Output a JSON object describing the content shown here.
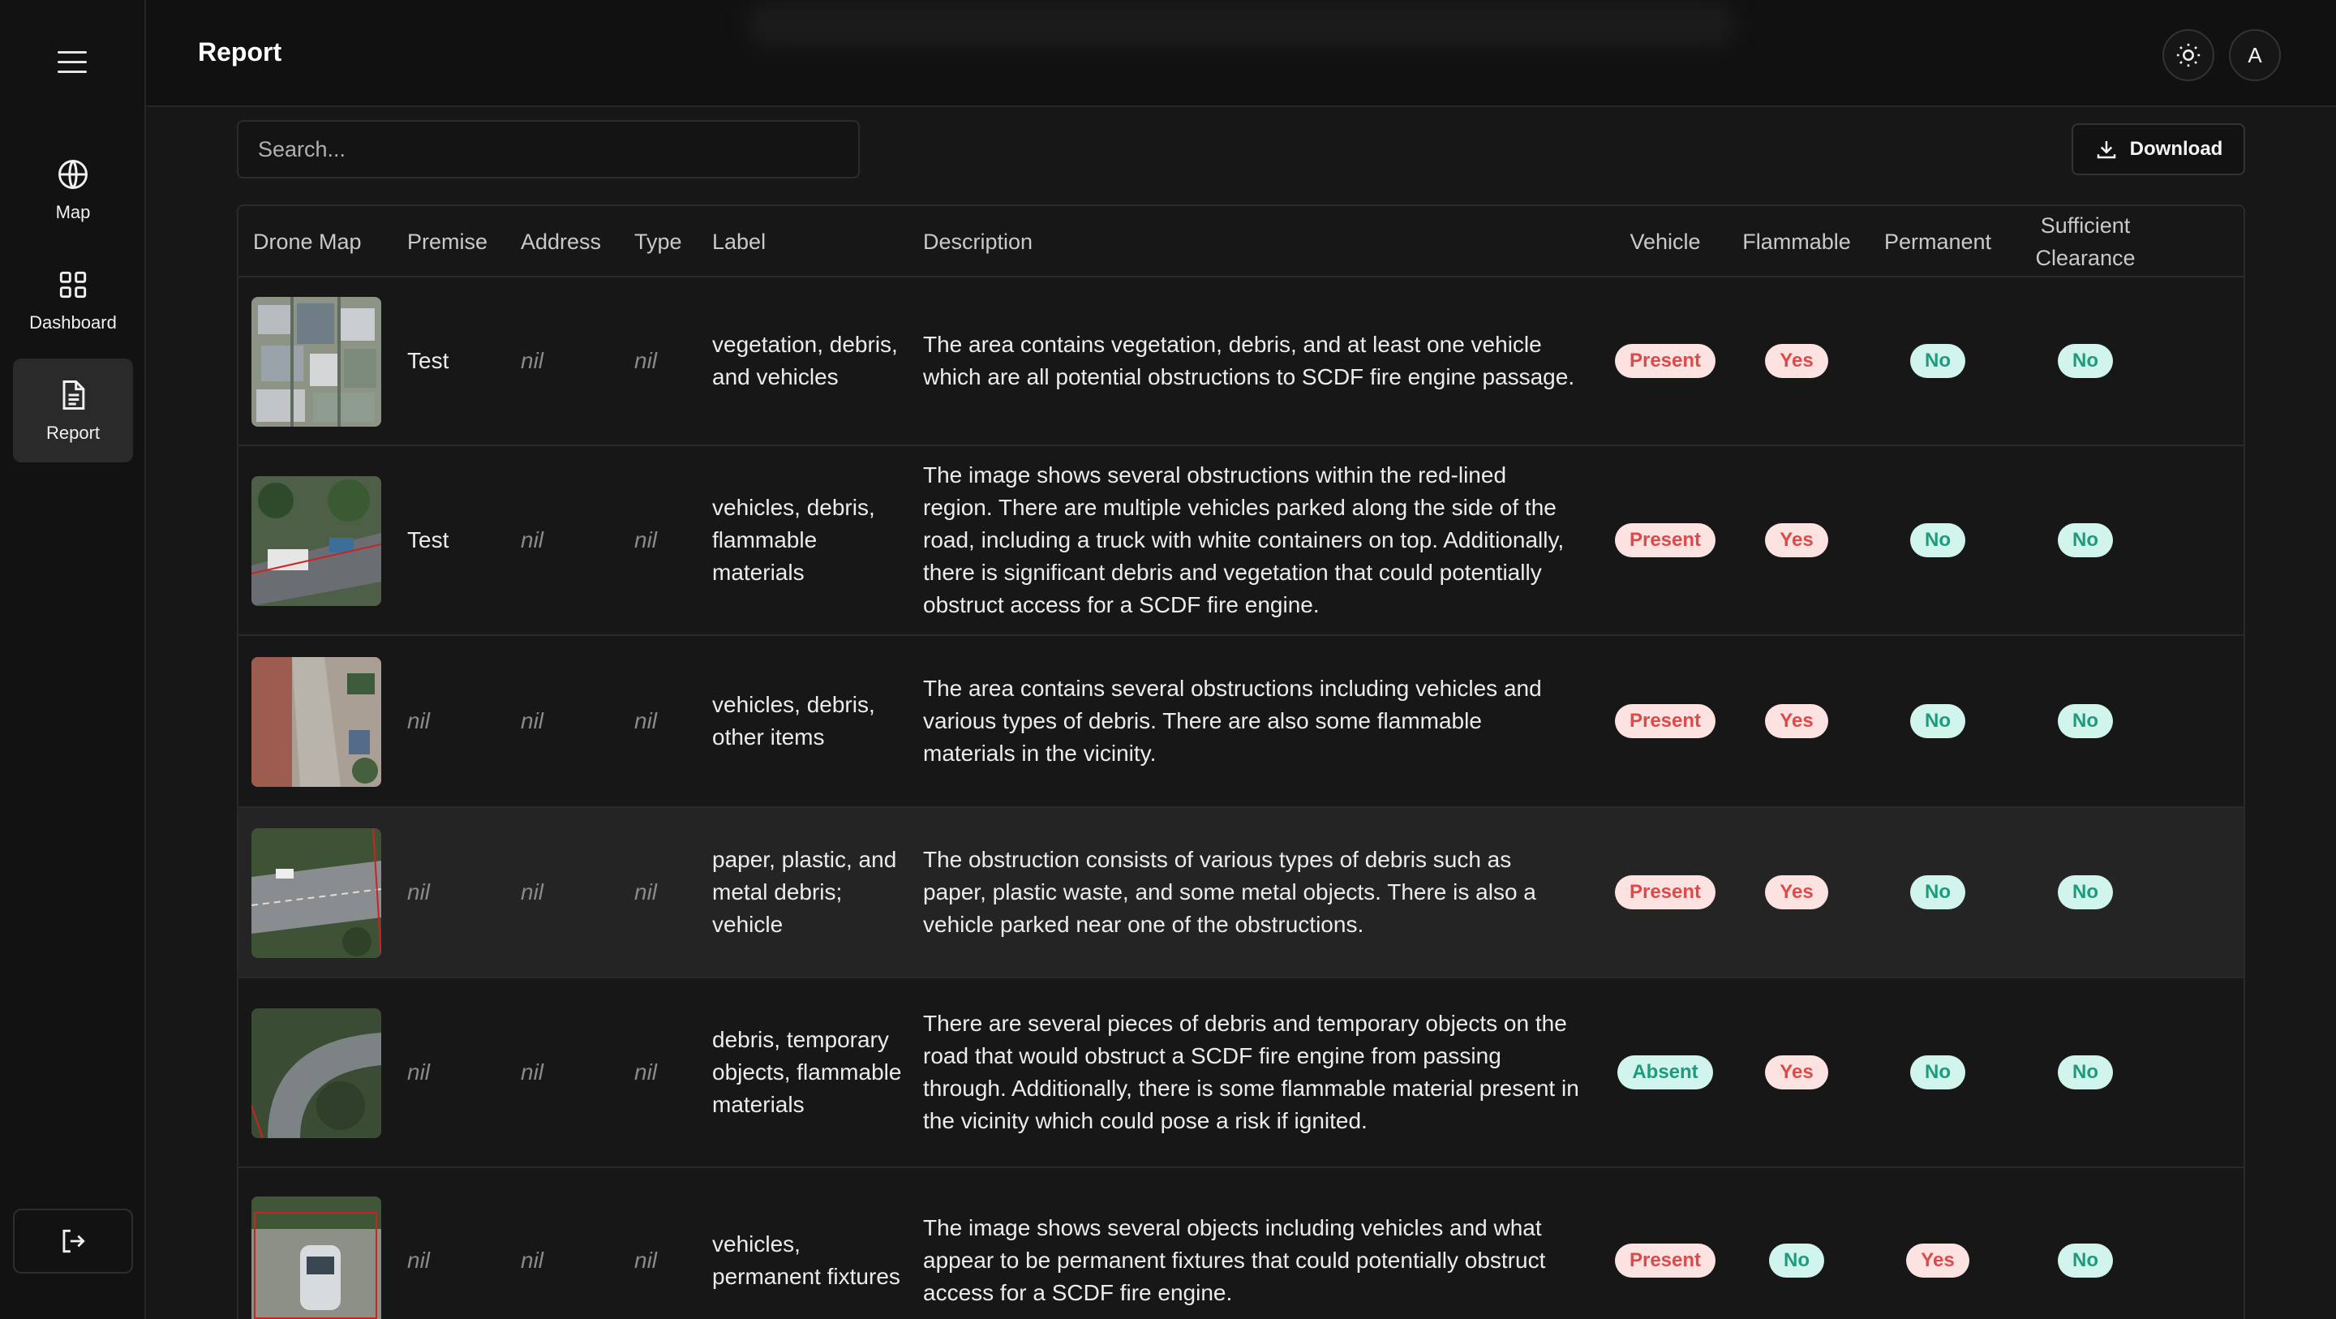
{
  "sidebar": {
    "nav": [
      {
        "label": "Map",
        "icon": "globe-icon"
      },
      {
        "label": "Dashboard",
        "icon": "grid-icon"
      },
      {
        "label": "Report",
        "icon": "document-icon",
        "active": true
      }
    ],
    "logout_icon": "logout-icon"
  },
  "header": {
    "title": "Report",
    "theme_icon": "sun-icon",
    "avatar_initial": "A"
  },
  "toolbar": {
    "search_placeholder": "Search...",
    "download_label": "Download"
  },
  "table": {
    "columns": [
      "Drone Map",
      "Premise",
      "Address",
      "Type",
      "Label",
      "Description",
      "Vehicle",
      "Flammable",
      "Permanent",
      "Sufficient Clearance"
    ],
    "rows": [
      {
        "premise": "Test",
        "address": "nil",
        "type": "nil",
        "label": "vegetation, debris, and vehicles",
        "description": "The area contains vegetation, debris, and at least one vehicle which are all potential obstructions to SCDF fire engine passage.",
        "vehicle": "Present",
        "flammable": "Yes",
        "permanent": "No",
        "clearance": "No"
      },
      {
        "premise": "Test",
        "address": "nil",
        "type": "nil",
        "label": "vehicles, debris, flammable materials",
        "description": "The image shows several obstructions within the red-lined region. There are multiple vehicles parked along the side of the road, including a truck with white containers on top. Additionally, there is significant debris and vegetation that could potentially obstruct access for a SCDF fire engine.",
        "vehicle": "Present",
        "flammable": "Yes",
        "permanent": "No",
        "clearance": "No"
      },
      {
        "premise": "nil",
        "address": "nil",
        "type": "nil",
        "label": "vehicles, debris, other items",
        "description": "The area contains several obstructions including vehicles and various types of debris. There are also some flammable materials in the vicinity.",
        "vehicle": "Present",
        "flammable": "Yes",
        "permanent": "No",
        "clearance": "No"
      },
      {
        "premise": "nil",
        "address": "nil",
        "type": "nil",
        "label": "paper, plastic, and metal debris; vehicle",
        "description": "The obstruction consists of various types of debris such as paper, plastic waste, and some metal objects. There is also a vehicle parked near one of the obstructions.",
        "vehicle": "Present",
        "flammable": "Yes",
        "permanent": "No",
        "clearance": "No"
      },
      {
        "premise": "nil",
        "address": "nil",
        "type": "nil",
        "label": "debris, temporary objects, flammable materials",
        "description": "There are several pieces of debris and temporary objects on the road that would obstruct a SCDF fire engine from passing through. Additionally, there is some flammable material present in the vicinity which could pose a risk if ignited.",
        "vehicle": "Absent",
        "flammable": "Yes",
        "permanent": "No",
        "clearance": "No"
      },
      {
        "premise": "nil",
        "address": "nil",
        "type": "nil",
        "label": "vehicles, permanent fixtures",
        "description": "The image shows several objects including vehicles and what appear to be permanent fixtures that could potentially obstruct access for a SCDF fire engine.",
        "vehicle": "Present",
        "flammable": "No",
        "permanent": "Yes",
        "clearance": "No"
      }
    ]
  },
  "colors": {
    "badge_red_bg": "#fde2e2",
    "badge_red_fg": "#dc4a4a",
    "badge_green_bg": "#d1f5ec",
    "badge_green_fg": "#1f9a7c"
  }
}
